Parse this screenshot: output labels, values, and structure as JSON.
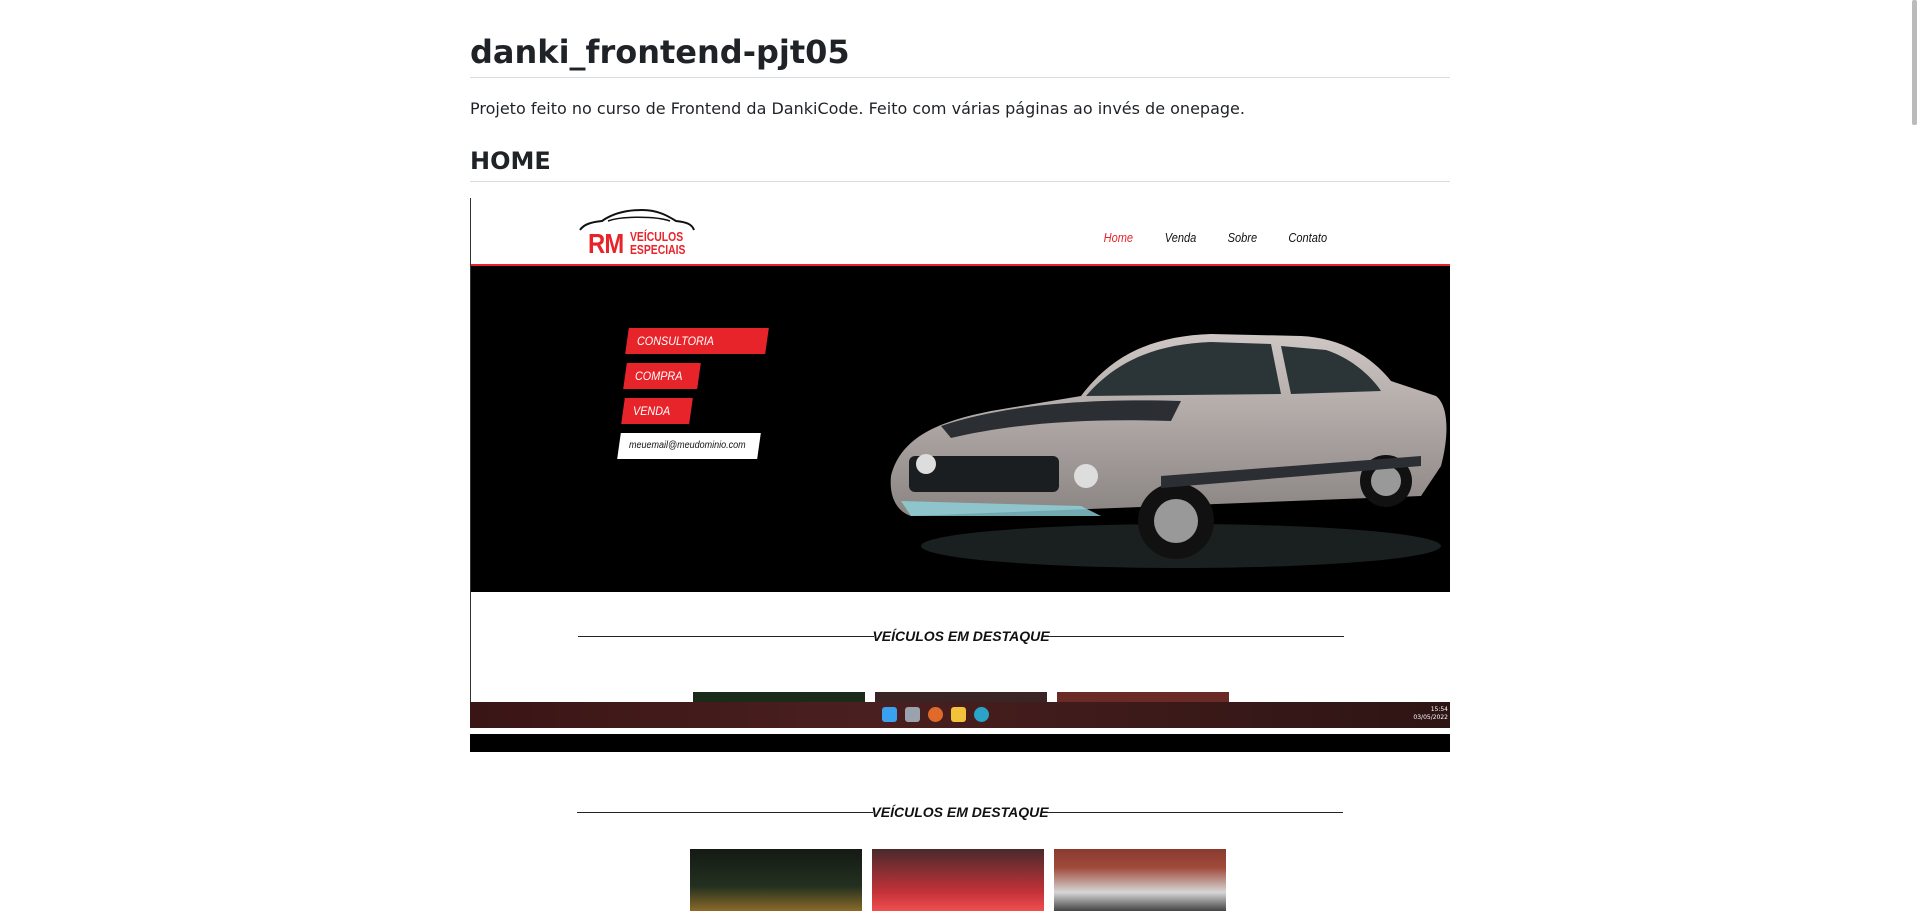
{
  "readme": {
    "title": "danki_frontend-pjt05",
    "description": "Projeto feito no curso de Frontend da DankiCode. Feito com várias páginas ao invés de onepage.",
    "section_home": "HOME"
  },
  "site": {
    "logo_rm": "RM",
    "logo_line1": "VEÍCULOS",
    "logo_line2": "ESPECIAIS",
    "nav": [
      "Home",
      "Venda",
      "Sobre",
      "Contato"
    ],
    "hero_tags": [
      "CONSULTORIA",
      "COMPRA",
      "VENDA"
    ],
    "hero_email": "meuemail@meudominio.com",
    "destaque_title": "VEÍCULOS EM DESTAQUE"
  },
  "taskbar": {
    "time": "15:54",
    "date": "03/05/2022"
  },
  "page_section": {
    "destaque_title": "VEÍCULOS EM DESTAQUE"
  },
  "colors": {
    "brand_red": "#e8242b",
    "hero_bg": "#000000"
  }
}
